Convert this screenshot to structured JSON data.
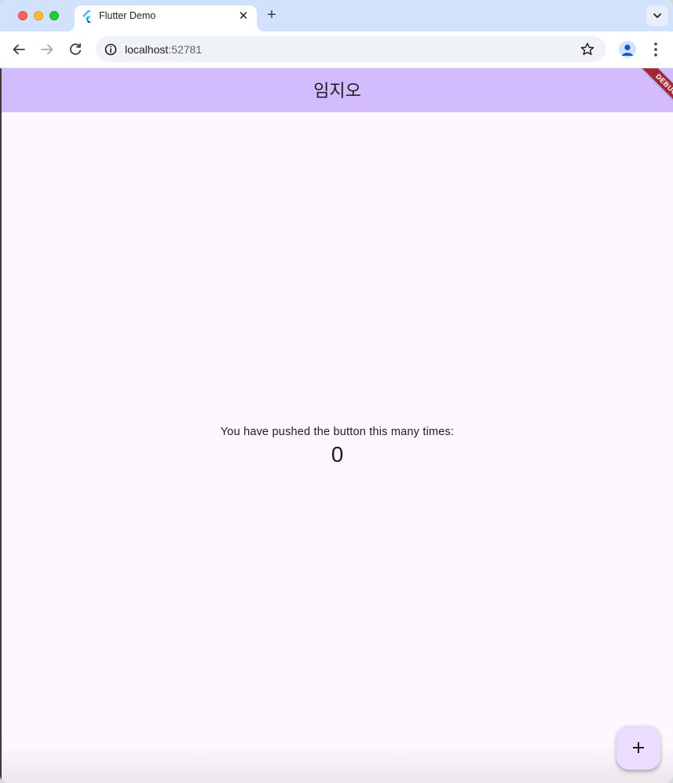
{
  "browser": {
    "tab": {
      "title": "Flutter Demo",
      "favicon": "flutter-icon",
      "close_glyph": "✕"
    },
    "new_tab_glyph": "+",
    "address_bar": {
      "host": "localhost",
      "port": ":52781"
    },
    "icons": [
      "back-arrow-icon",
      "forward-arrow-icon",
      "reload-icon",
      "site-info-icon",
      "bookmark-star-icon",
      "profile-avatar-icon",
      "more-vert-icon",
      "tab-search-chevron-icon"
    ]
  },
  "app": {
    "appbar_title": "임지오",
    "debug_banner": "DEBUG",
    "counter_label": "You have pushed the button this many times:",
    "counter_value": "0",
    "fab_icon": "add-icon"
  },
  "colors": {
    "appbar": "#d2bcfd",
    "background": "#fdf7fe",
    "fab": "#eaddff",
    "debug_banner": "#a12836",
    "tabstrip": "#d3e2fc"
  }
}
